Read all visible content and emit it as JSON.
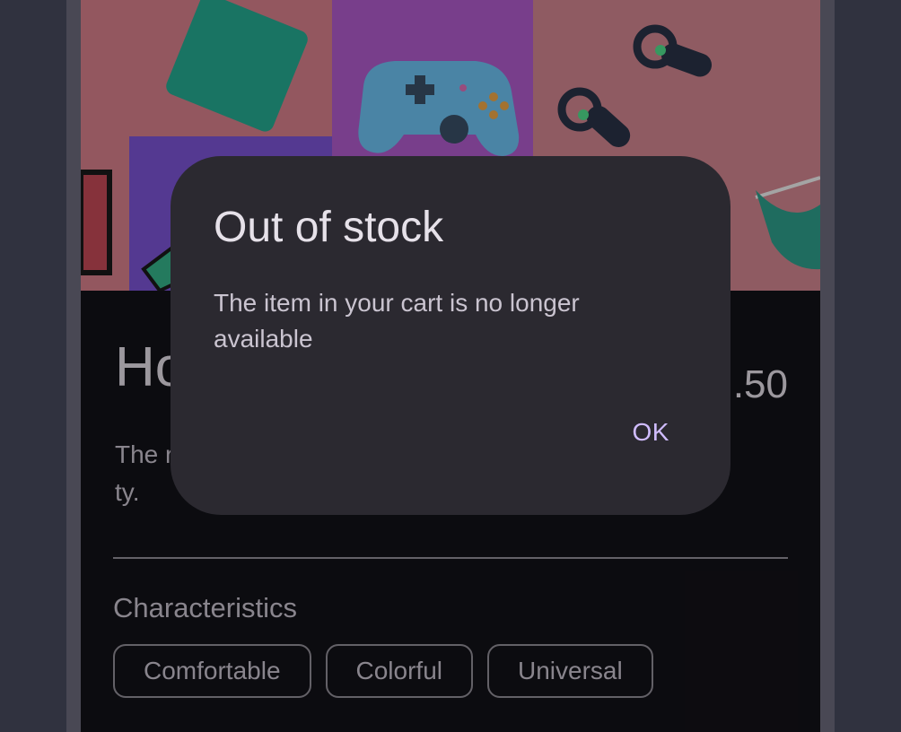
{
  "product": {
    "title": "Ho",
    "price": ".50",
    "description": "The r                                                                   t, thank                                                                  ty."
  },
  "characteristics": {
    "title": "Characteristics",
    "chips": [
      "Comfortable",
      "Colorful",
      "Universal"
    ]
  },
  "dialog": {
    "title": "Out of stock",
    "message": "The item in your cart is no longer available",
    "confirm_label": "OK"
  },
  "colors": {
    "background": "#484a5d",
    "surface": "#131218",
    "dialog_surface": "#2b2930",
    "accent": "#d0bcff"
  },
  "icons": [
    "game-controller-icon",
    "vr-controller-icon"
  ]
}
